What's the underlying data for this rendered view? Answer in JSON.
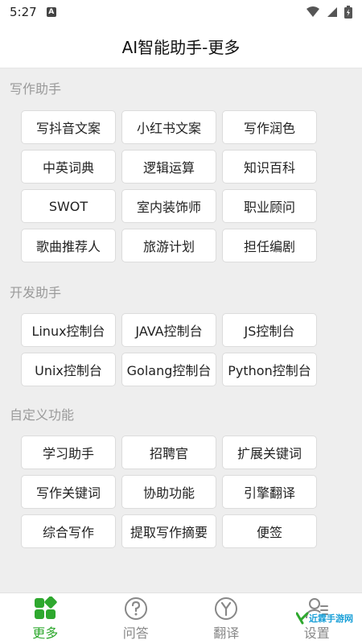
{
  "status_bar": {
    "time": "5:27",
    "app_badge": "A"
  },
  "header": {
    "title": "AI智能助手-更多"
  },
  "sections": [
    {
      "label": "写作助手",
      "items": [
        "写抖音文案",
        "小红书文案",
        "写作润色",
        "中英词典",
        "逻辑运算",
        "知识百科",
        "SWOT",
        "室内装饰师",
        "职业顾问",
        "歌曲推荐人",
        "旅游计划",
        "担任编剧"
      ]
    },
    {
      "label": "开发助手",
      "items": [
        "Linux控制台",
        "JAVA控制台",
        "JS控制台",
        "Unix控制台",
        "Golang控制台",
        "Python控制台"
      ]
    },
    {
      "label": "自定义功能",
      "items": [
        "学习助手",
        "招聘官",
        "扩展关键词",
        "写作关键词",
        "协助功能",
        "引擎翻译",
        "综合写作",
        "提取写作摘要",
        "便签"
      ]
    }
  ],
  "bottom_nav": {
    "items": [
      {
        "label": "更多",
        "icon": "grid-icon",
        "active": true
      },
      {
        "label": "问答",
        "icon": "question-icon",
        "active": false
      },
      {
        "label": "翻译",
        "icon": "translate-icon",
        "active": false
      },
      {
        "label": "设置",
        "icon": "user-settings-icon",
        "active": false
      }
    ]
  },
  "watermark": {
    "text": "近霖手游网"
  },
  "colors": {
    "accent": "#2ea82e",
    "inactive": "#888888",
    "section_label": "#9a9a9a"
  }
}
